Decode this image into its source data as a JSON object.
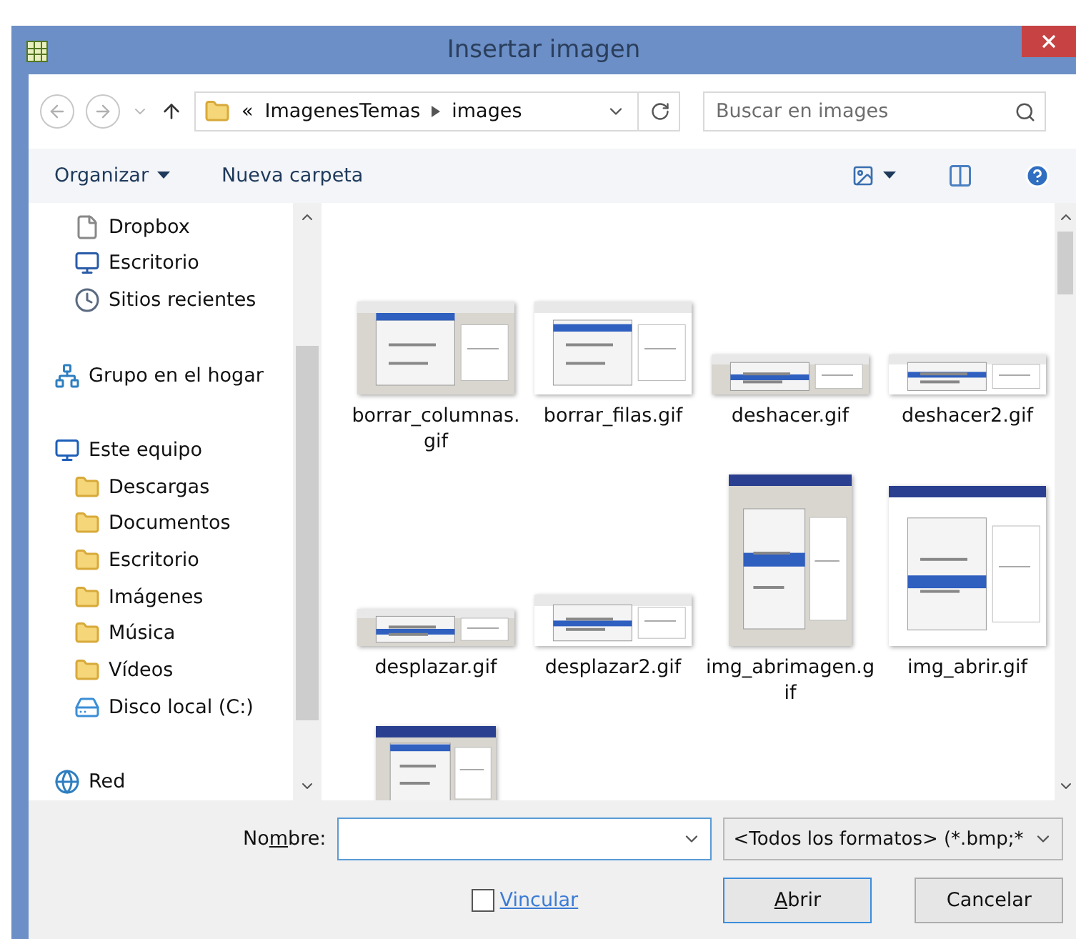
{
  "window": {
    "title": "Insertar imagen"
  },
  "navigation": {
    "path_prefix": "«",
    "path": [
      "ImagenesTemas",
      "images"
    ],
    "search": {
      "placeholder": "Buscar en images"
    }
  },
  "toolbar": {
    "organize": "Organizar",
    "new_folder": "Nueva carpeta"
  },
  "sidebar": {
    "items": [
      {
        "label": "Dropbox",
        "kind": "file",
        "indented": true
      },
      {
        "label": "Escritorio",
        "kind": "desktop",
        "indented": true
      },
      {
        "label": "Sitios recientes",
        "kind": "recent",
        "indented": true
      },
      {
        "label": "Grupo en el hogar",
        "kind": "homegroup",
        "indented": false,
        "gap": true
      },
      {
        "label": "Este equipo",
        "kind": "computer",
        "indented": false,
        "gap": true
      },
      {
        "label": "Descargas",
        "kind": "folder",
        "indented": true
      },
      {
        "label": "Documentos",
        "kind": "folder",
        "indented": true
      },
      {
        "label": "Escritorio",
        "kind": "folder",
        "indented": true
      },
      {
        "label": "Imágenes",
        "kind": "folder",
        "indented": true
      },
      {
        "label": "Música",
        "kind": "folder",
        "indented": true
      },
      {
        "label": "Vídeos",
        "kind": "folder",
        "indented": true
      },
      {
        "label": "Disco local (C:)",
        "kind": "drive",
        "indented": true
      },
      {
        "label": "Red",
        "kind": "network",
        "indented": false,
        "gap": true
      }
    ]
  },
  "files": [
    {
      "name": "borrar_columnas.\ngif"
    },
    {
      "name": "borrar_filas.gif"
    },
    {
      "name": "deshacer.gif"
    },
    {
      "name": "deshacer2.gif"
    },
    {
      "name": "desplazar.gif"
    },
    {
      "name": "desplazar2.gif"
    },
    {
      "name": "img_abrimagen.g\nif"
    },
    {
      "name": "img_abrir.gif"
    },
    {
      "kind": "picture"
    }
  ],
  "footer": {
    "name_label": {
      "before": "No",
      "key": "m",
      "after": "bre:"
    },
    "filter": "<Todos los formatos> (*.bmp;*",
    "link_checkbox": {
      "label": "Vincular",
      "checked": false
    },
    "buttons": [
      {
        "key": "A",
        "after": "brir",
        "default": true
      },
      {
        "after": "Cancelar",
        "default": false
      }
    ]
  }
}
